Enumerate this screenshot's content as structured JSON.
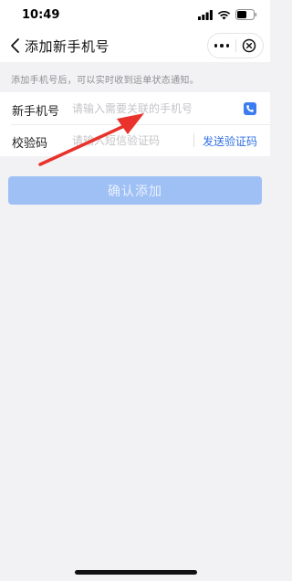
{
  "status_bar": {
    "time": "10:49"
  },
  "nav": {
    "title": "添加新手机号"
  },
  "notice": "添加手机号后，可以实时收到运单状态通知。",
  "form": {
    "phone": {
      "label": "新手机号",
      "placeholder": "请输入需要关联的手机号",
      "value": ""
    },
    "code": {
      "label": "校验码",
      "placeholder": "请输入短信验证码",
      "value": "",
      "send_label": "发送验证码"
    }
  },
  "confirm_button": {
    "label": "确认添加"
  },
  "colors": {
    "accent": "#2f6fe4",
    "button_disabled": "#9fc0f5",
    "annotation_arrow": "#e8322b"
  },
  "icons": [
    "back-icon",
    "more-icon",
    "close-circle-icon",
    "phone-contact-icon",
    "annotation-arrow"
  ]
}
